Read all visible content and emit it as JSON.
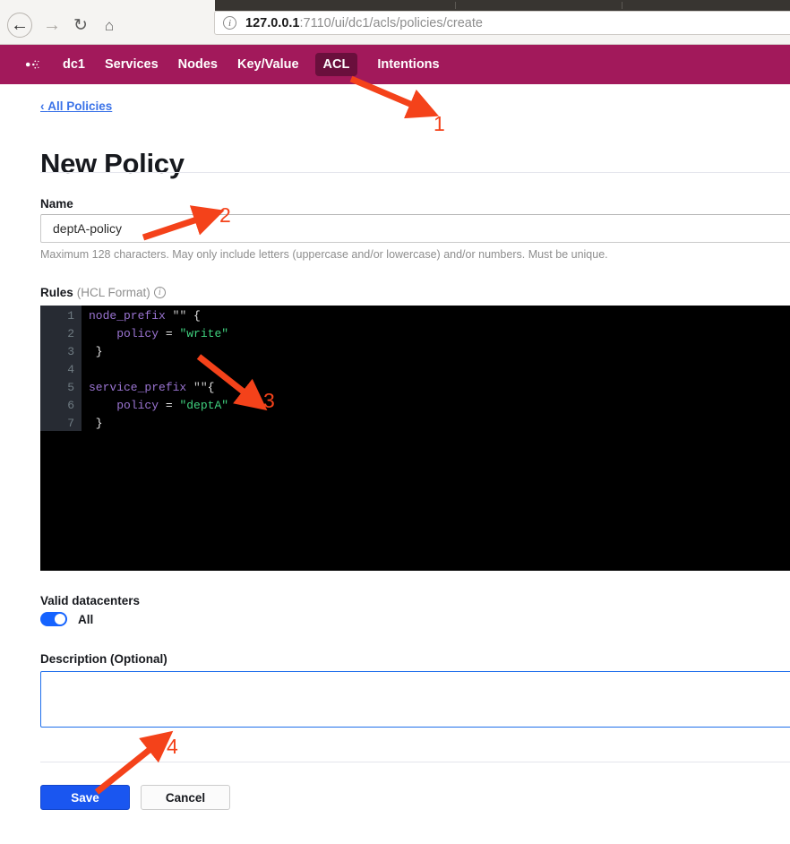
{
  "browser": {
    "back_icon": "arrow-left-icon",
    "forward_icon": "arrow-right-icon",
    "reload_icon": "reload-icon",
    "home_icon": "home-icon",
    "identity_icon": "info-circle-icon",
    "url_host": "127.0.0.1",
    "url_path": ":7110/ui/dc1/acls/policies/create",
    "url_full": "127.0.0.1:7110/ui/dc1/acls/policies/create"
  },
  "navbar": {
    "logo_icon": "consul-logo-icon",
    "items": [
      {
        "label": "dc1",
        "active": false
      },
      {
        "label": "Services",
        "active": false
      },
      {
        "label": "Nodes",
        "active": false
      },
      {
        "label": "Key/Value",
        "active": false
      },
      {
        "label": "ACL",
        "active": true
      },
      {
        "label": "Intentions",
        "active": false
      }
    ],
    "background_color": "#a2195b",
    "active_background_color": "#6a0f3c"
  },
  "page": {
    "breadcrumb_icon": "chevron-left-icon",
    "breadcrumb": "All Policies",
    "title": "New Policy"
  },
  "form": {
    "name": {
      "label": "Name",
      "value": "deptA-policy",
      "placeholder": "",
      "hint": "Maximum 128 characters. May only include letters (uppercase and/or lowercase) and/or numbers. Must be unique."
    },
    "rules": {
      "label": "Rules",
      "format": "(HCL Format)",
      "info_icon": "info-circle-icon",
      "lines": [
        {
          "n": "1",
          "tokens": [
            {
              "t": "node_prefix",
              "c": "kw"
            },
            {
              "t": " ",
              "c": "pun"
            },
            {
              "t": "\"\"",
              "c": "emp"
            },
            {
              "t": " {",
              "c": "pun"
            }
          ]
        },
        {
          "n": "2",
          "tokens": [
            {
              "t": "    ",
              "c": "pun"
            },
            {
              "t": "policy",
              "c": "kw"
            },
            {
              "t": " = ",
              "c": "op"
            },
            {
              "t": "\"write\"",
              "c": "str"
            }
          ]
        },
        {
          "n": "3",
          "tokens": [
            {
              "t": " }",
              "c": "pun"
            }
          ]
        },
        {
          "n": "4",
          "tokens": [
            {
              "t": "",
              "c": "pun"
            }
          ]
        },
        {
          "n": "5",
          "tokens": [
            {
              "t": "service_prefix",
              "c": "kw"
            },
            {
              "t": " ",
              "c": "pun"
            },
            {
              "t": "\"\"",
              "c": "emp"
            },
            {
              "t": "{",
              "c": "pun"
            }
          ]
        },
        {
          "n": "6",
          "tokens": [
            {
              "t": "    ",
              "c": "pun"
            },
            {
              "t": "policy",
              "c": "kw"
            },
            {
              "t": " = ",
              "c": "op"
            },
            {
              "t": "\"deptA\"",
              "c": "str"
            }
          ]
        },
        {
          "n": "7",
          "tokens": [
            {
              "t": " }",
              "c": "pun"
            }
          ]
        }
      ],
      "plain_text": "node_prefix \"\" {\n    policy = \"write\"\n }\n\nservice_prefix \"\"{\n    policy = \"deptA\"\n }"
    },
    "valid_datacenters": {
      "label": "Valid datacenters",
      "toggle_label": "All",
      "toggle_on": true,
      "toggle_color": "#1563ff"
    },
    "description": {
      "label": "Description (Optional)",
      "value": "",
      "placeholder": ""
    },
    "save_label": "Save",
    "cancel_label": "Cancel"
  },
  "annotations": {
    "color": "#f4421a",
    "markers": [
      {
        "number": "1",
        "target": "acl-nav-tab"
      },
      {
        "number": "2",
        "target": "name-input"
      },
      {
        "number": "3",
        "target": "rules-code-editor"
      },
      {
        "number": "4",
        "target": "save-button"
      }
    ]
  }
}
